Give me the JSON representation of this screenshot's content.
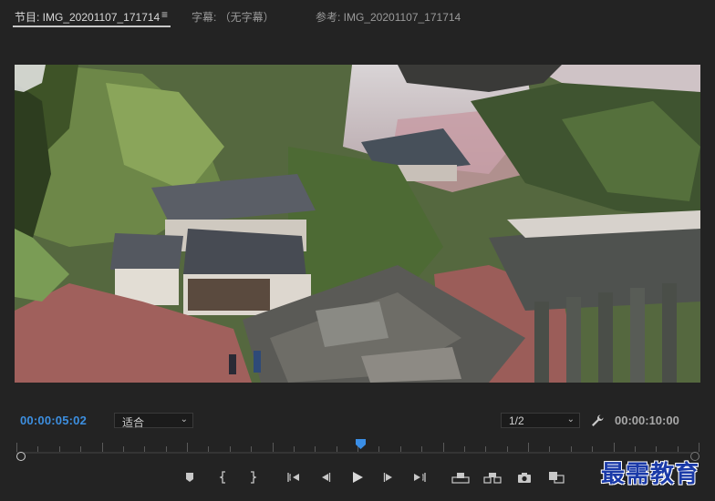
{
  "tabs": {
    "program_label": "节目: IMG_20201107_171714",
    "menu_icon": "hamburger-icon",
    "captions_label": "字幕: （无字幕）",
    "reference_label": "参考: IMG_20201107_171714"
  },
  "monitor": {
    "content": "video-frame"
  },
  "controls": {
    "current_timecode": "00:00:05:02",
    "fit_option": "适合",
    "resolution_option": "1/2",
    "duration_timecode": "00:00:10:00",
    "wrench_icon": "wrench-icon"
  },
  "transport": {
    "buttons": [
      {
        "name": "add-marker-button",
        "icon": "marker-icon"
      },
      {
        "name": "mark-in-button",
        "icon": "mark-in-icon"
      },
      {
        "name": "mark-out-button",
        "icon": "mark-out-icon"
      },
      {
        "name": "go-to-in-button",
        "icon": "go-to-in-icon"
      },
      {
        "name": "step-back-button",
        "icon": "step-back-icon"
      },
      {
        "name": "play-button",
        "icon": "play-icon"
      },
      {
        "name": "step-forward-button",
        "icon": "step-forward-icon"
      },
      {
        "name": "go-to-out-button",
        "icon": "go-to-out-icon"
      },
      {
        "name": "lift-button",
        "icon": "lift-icon"
      },
      {
        "name": "extract-button",
        "icon": "extract-icon"
      },
      {
        "name": "export-frame-button",
        "icon": "camera-icon"
      },
      {
        "name": "compare-view-button",
        "icon": "compare-icon"
      }
    ]
  },
  "playhead_fraction": 0.505,
  "watermark": "最需教育"
}
